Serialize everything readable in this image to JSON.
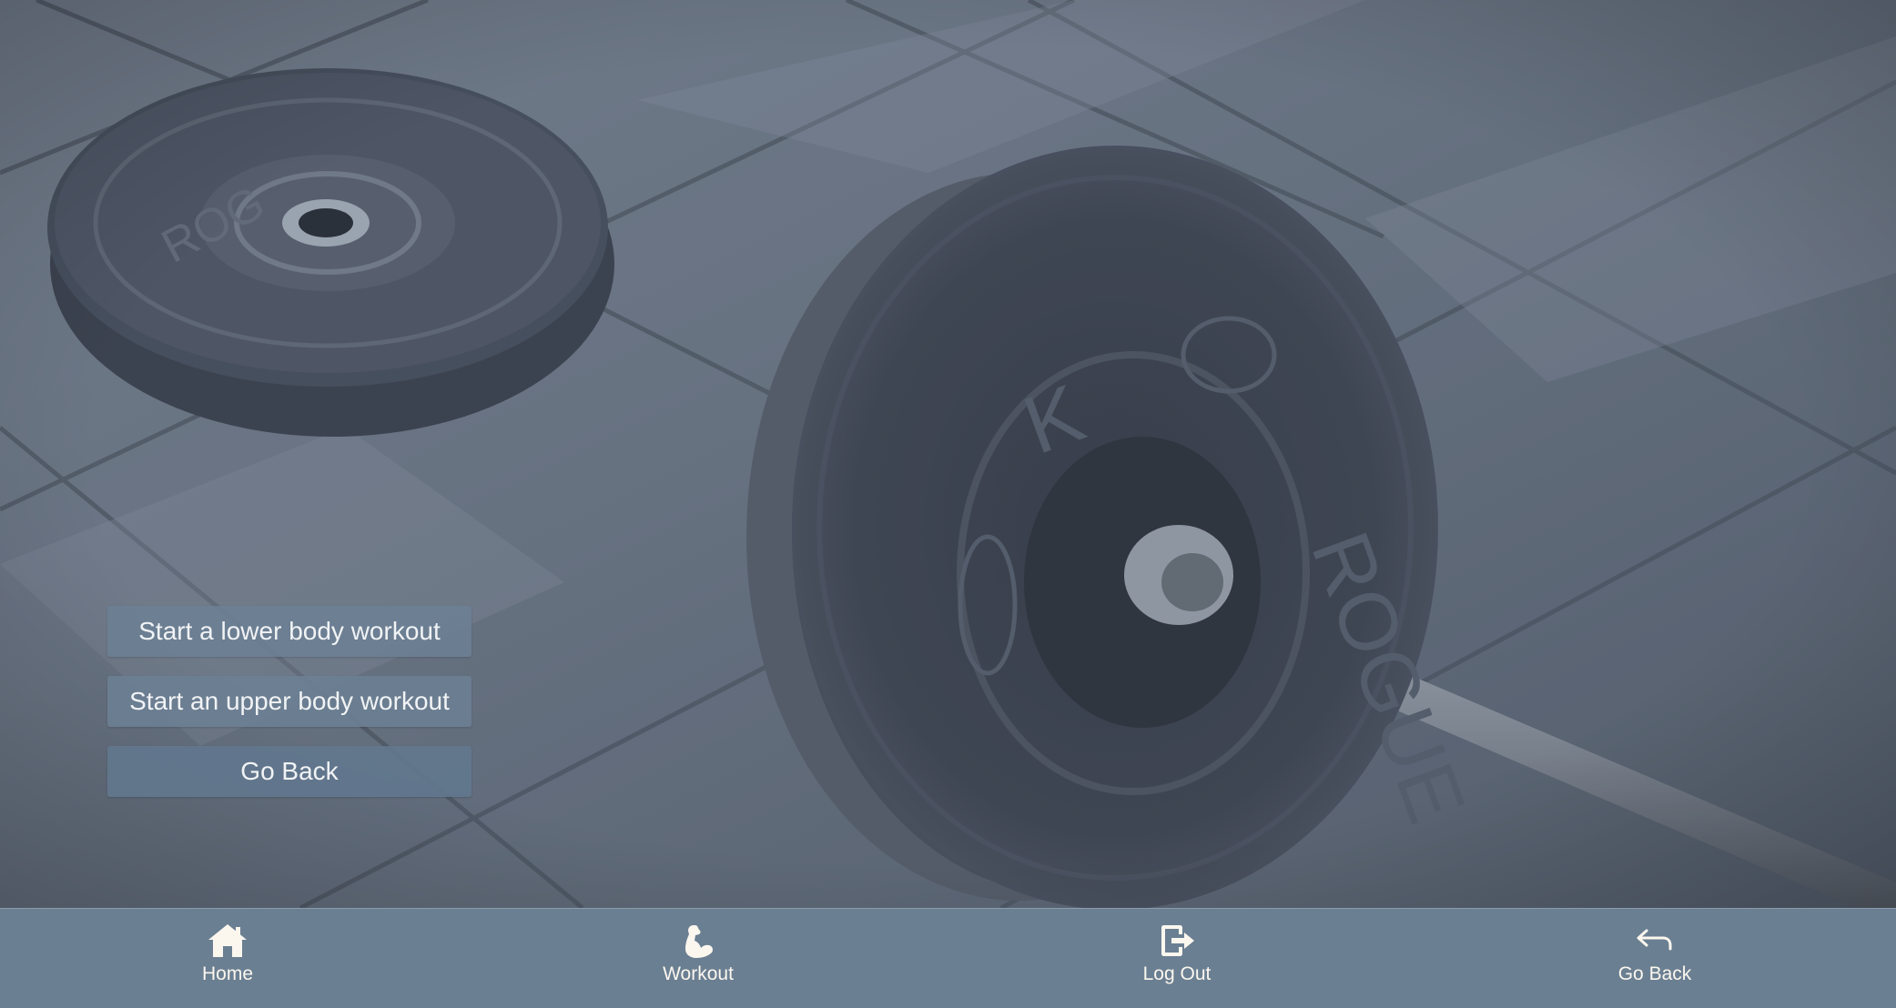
{
  "menu": {
    "lower_body_label": "Start a lower body workout",
    "upper_body_label": "Start an upper body workout",
    "go_back_label": "Go Back"
  },
  "bottom_nav": {
    "items": [
      {
        "label": "Home",
        "icon": "home-icon"
      },
      {
        "label": "Workout",
        "icon": "bicep-icon"
      },
      {
        "label": "Log Out",
        "icon": "logout-icon"
      },
      {
        "label": "Go Back",
        "icon": "back-arrow-icon"
      }
    ]
  },
  "colors": {
    "nav_background": "#6b7f92",
    "button_background": "#6c8094",
    "nav_text": "#fbf7ef"
  }
}
